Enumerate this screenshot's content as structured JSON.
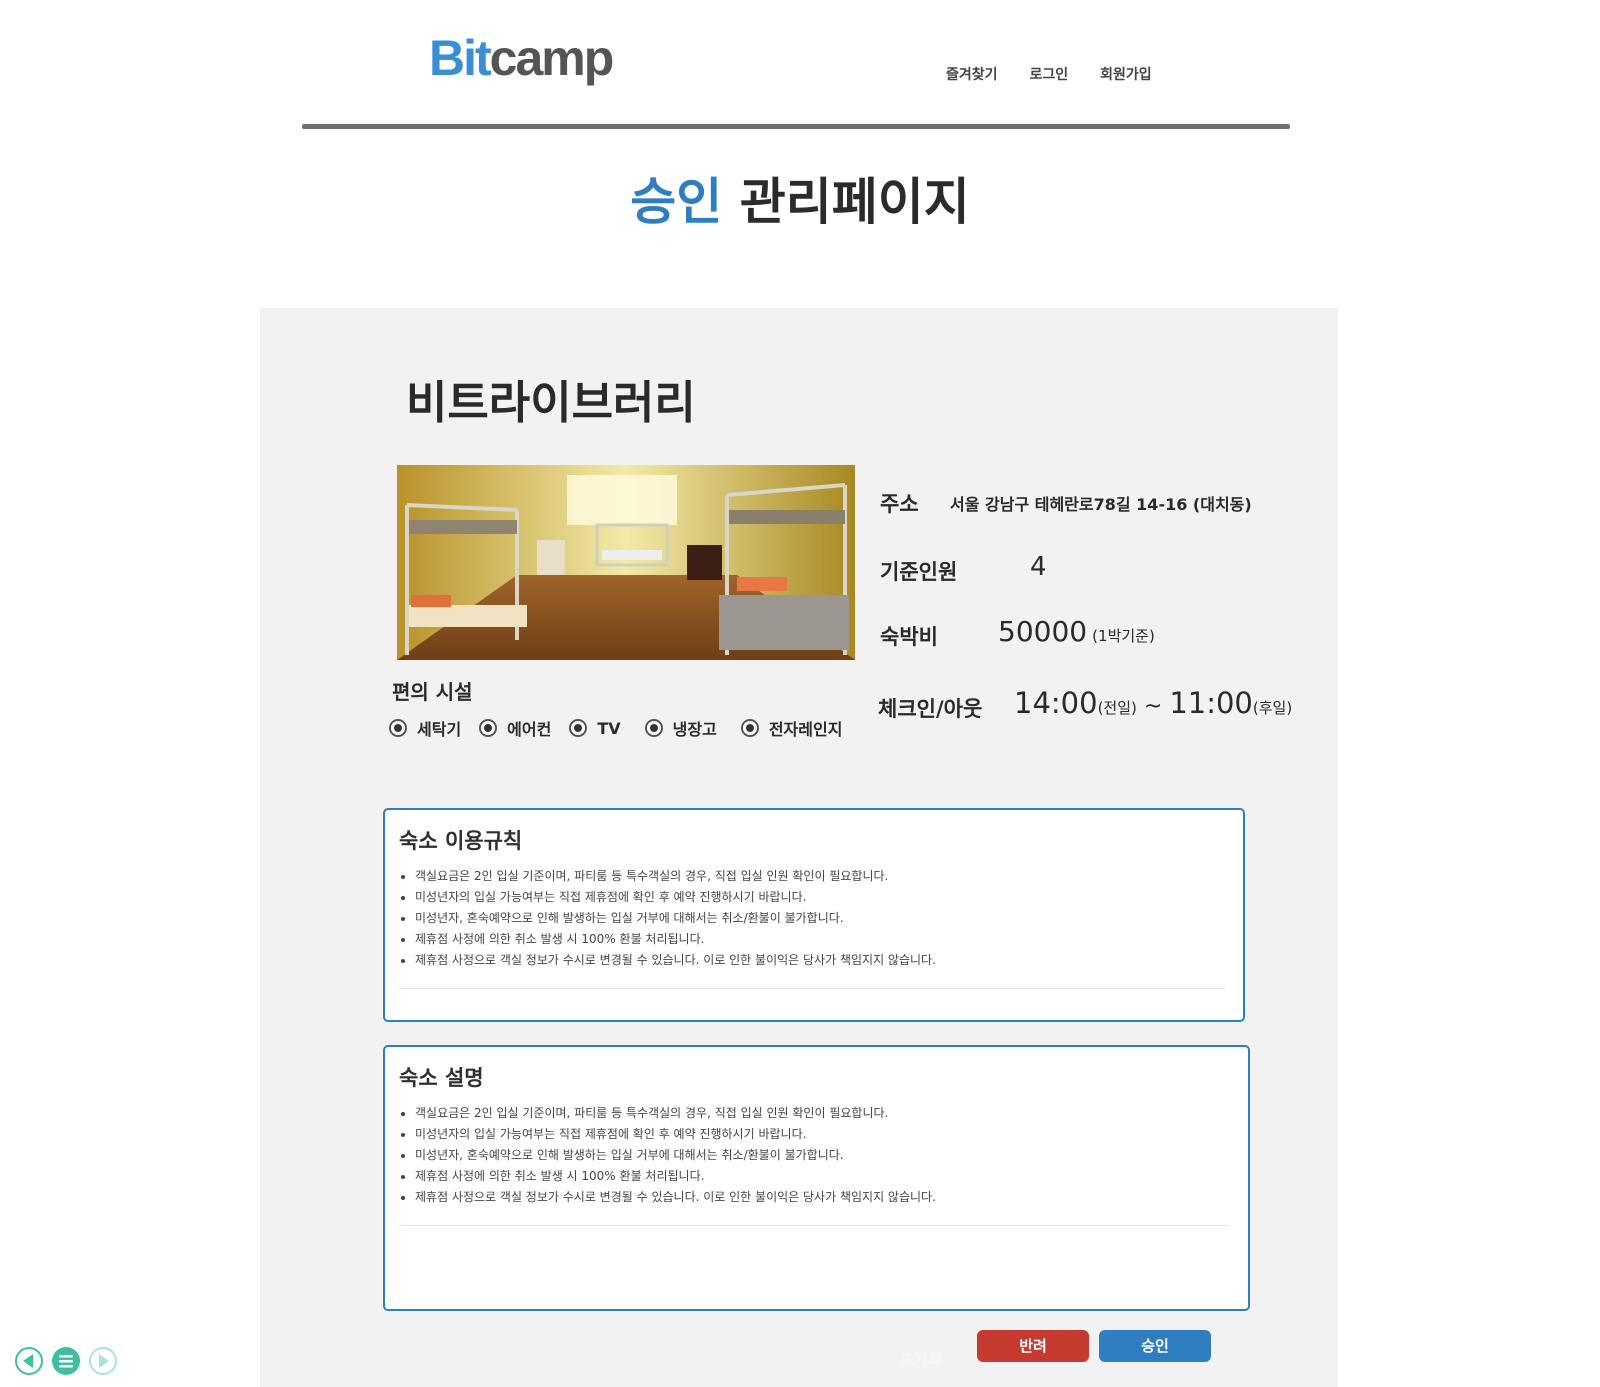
{
  "header": {
    "logo_part1": "Bit",
    "logo_part2": "camp",
    "nav": {
      "bookmark": "즐겨찾기",
      "login": "로그인",
      "signup": "회원가입"
    }
  },
  "page_title": {
    "accent": "승인",
    "rest": " 관리페이지"
  },
  "accommodation": {
    "name": "비트라이브러리",
    "facilities_title": "편의 시설",
    "facilities": [
      "세탁기",
      "에어컨",
      "TV",
      "냉장고",
      "전자레인지"
    ],
    "address_label": "주소",
    "address": "서울 강남구 테헤란로78길 14-16 (대치동)",
    "capacity_label": "기준인원",
    "capacity": "4",
    "price_label": "숙박비",
    "price": "50000",
    "price_unit": "(1박기준)",
    "checkinout_label": "체크인/아웃",
    "checkin_time": "14:00",
    "checkin_note": "(전일)",
    "separator": " ~ ",
    "checkout_time": "11:00",
    "checkout_note": "(후일)"
  },
  "rules": {
    "title": "숙소 이용규칙",
    "items": [
      "객실요금은 2인 입실 기준이며, 파티룸 등 특수객실의 경우, 직접 입실 인원 확인이 필요합니다.",
      "미성년자의 입실 가능여부는 직접 제휴점에 확인 후 예약 진행하시기 바랍니다.",
      "미성년자, 혼숙예약으로 인해 발생하는 입실 거부에 대해서는 취소/환불이 불가합니다.",
      "제휴점 사정에 의한 취소 발생 시 100% 환불 처리됩니다.",
      "제휴점 사정으로 객실 정보가 수시로 변경될 수 있습니다. 이로 인한 불이익은 당사가 책임지지 않습니다."
    ]
  },
  "description": {
    "title": "숙소 설명",
    "items": [
      "객실요금은 2인 입실 기준이며, 파티룸 등 특수객실의 경우, 직접 입실 인원 확인이 필요합니다.",
      "미성년자의 입실 가능여부는 직접 제휴점에 확인 후 예약 진행하시기 바랍니다.",
      "미성년자, 혼숙예약으로 인해 발생하는 입실 거부에 대해서는 취소/환불이 불가합니다.",
      "제휴점 사정에 의한 취소 발생 시 100% 환불 처리됩니다.",
      "제휴점 사정으로 객실 정보가 수시로 변경될 수 있습니다. 이로 인한 불이익은 당사가 책임지지 않습니다."
    ]
  },
  "actions": {
    "reset": "초기화",
    "reject": "반려",
    "approve": "승인"
  },
  "colors": {
    "accent": "#2f7fc0",
    "reject": "#c63a30",
    "viewer": "#3fbf9f"
  },
  "viewer_icons": [
    "prev-icon",
    "menu-icon",
    "next-icon"
  ]
}
